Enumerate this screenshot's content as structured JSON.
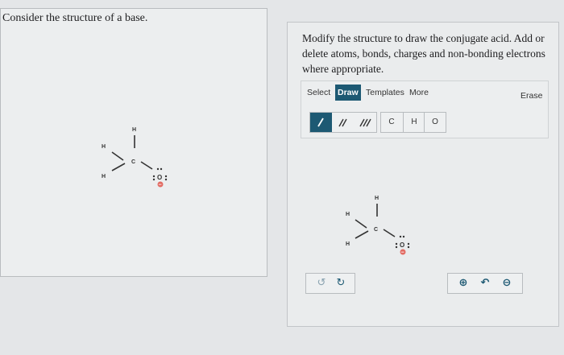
{
  "question": {
    "text": "Consider the structure of a base."
  },
  "instructions": {
    "text": "Modify the structure to draw the conjugate acid. Add or delete atoms, bonds, charges and non-bonding electrons where appropriate."
  },
  "editor": {
    "tabs": [
      "Select",
      "Draw",
      "Templates",
      "More"
    ],
    "active_tab": "Draw",
    "erase_label": "Erase",
    "bond_tools": [
      "single-bond",
      "double-bond",
      "triple-bond"
    ],
    "atom_tools": [
      "C",
      "H",
      "O"
    ],
    "undo_icon": "undo-icon",
    "redo_icon": "redo-icon",
    "zoom_tools": [
      "zoom-in-icon",
      "reset-zoom-icon",
      "zoom-out-icon"
    ]
  },
  "molecule": {
    "atoms": [
      "H",
      "H",
      "H",
      "C",
      "O"
    ],
    "charge": "−"
  },
  "colors": {
    "accent": "#1d5973",
    "charge": "#d9534f"
  }
}
